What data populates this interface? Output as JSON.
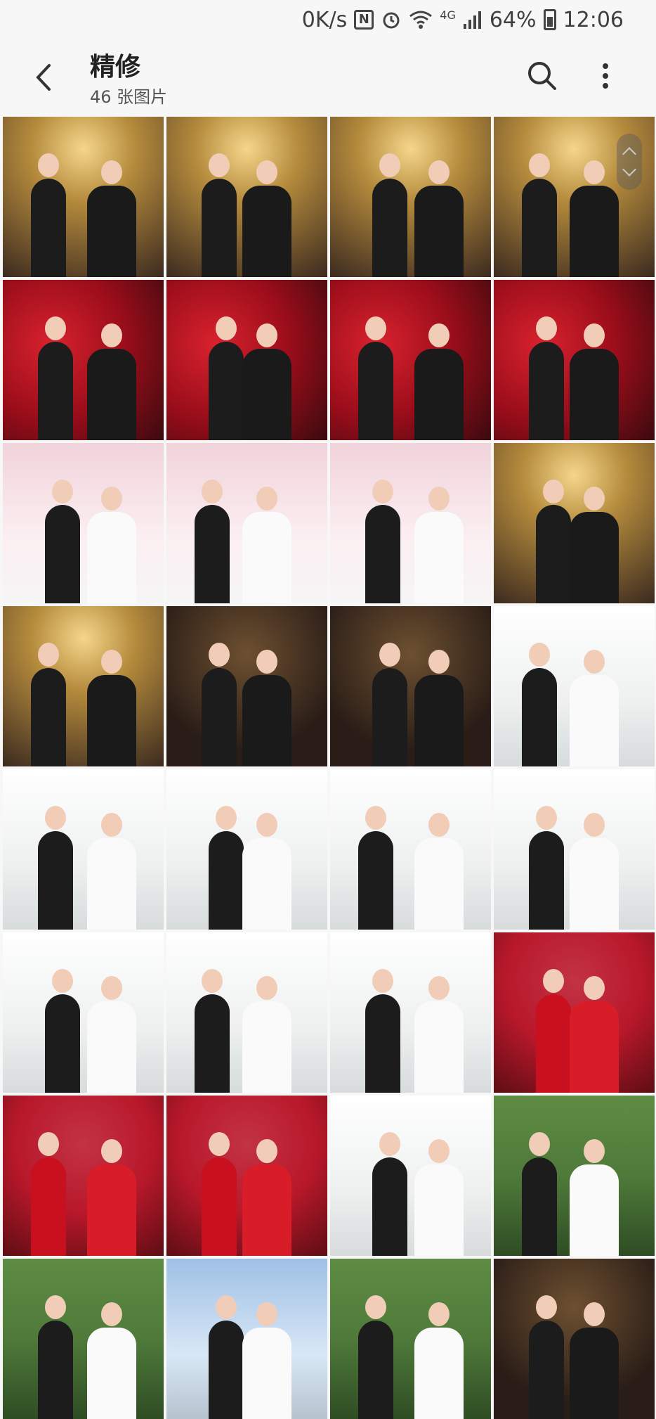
{
  "status": {
    "speed": "0K/s",
    "network": "4G",
    "battery": "64%",
    "time": "12:06",
    "icons": [
      "nfc-icon",
      "alarm-icon",
      "wifi-icon",
      "signal-icon",
      "battery-icon"
    ]
  },
  "header": {
    "title": "精修",
    "subtitle": "46 张图片"
  },
  "colors": {
    "gold": "#b48a3c",
    "rose": "#9b0d1a",
    "blossom": "#f0d3da",
    "white_studio": "#eef0f0",
    "dark": "#2a1d17",
    "red_trad": "#b8182a",
    "green": "#4f7a3a",
    "sky": "#9fc0e6"
  },
  "grid": {
    "tile_types": [
      "gold",
      "gold",
      "gold",
      "gold",
      "rose",
      "rose",
      "rose",
      "rose",
      "blossom",
      "blossom",
      "blossom",
      "gold",
      "gold",
      "dark",
      "dark",
      "white_studio",
      "white_studio",
      "white_studio",
      "white_studio",
      "white_studio",
      "white_studio",
      "white_studio",
      "white_studio",
      "red_trad",
      "red_trad",
      "red_trad",
      "white_studio",
      "green",
      "green",
      "sky",
      "green",
      "dark"
    ]
  }
}
